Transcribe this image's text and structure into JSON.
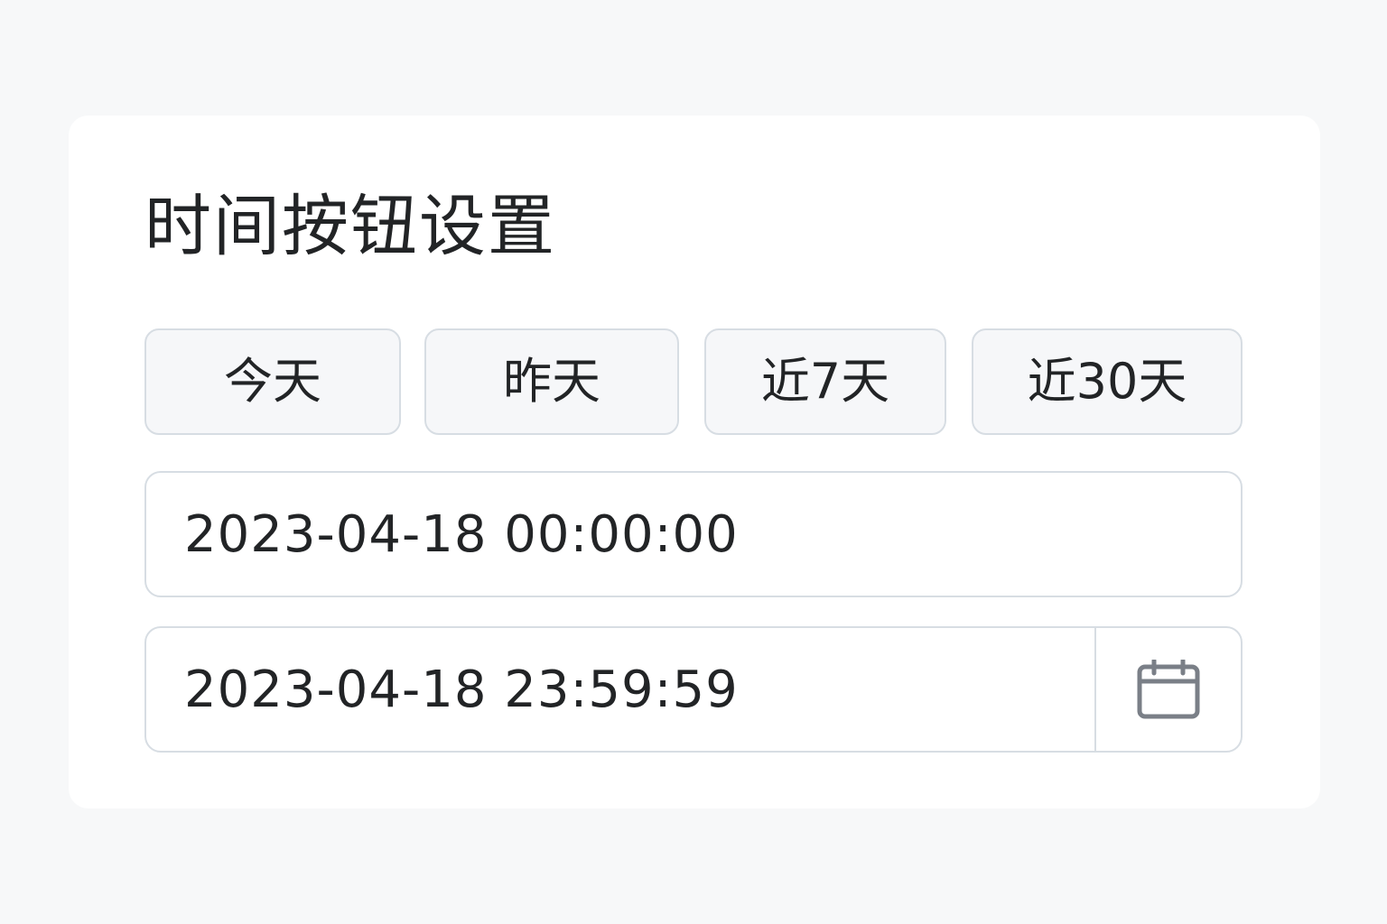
{
  "card": {
    "title": "时间按钮设置"
  },
  "quick_buttons": [
    {
      "label": "今天"
    },
    {
      "label": "昨天"
    },
    {
      "label": "近7天"
    },
    {
      "label": "近30天"
    }
  ],
  "range": {
    "start_value": "2023-04-18 00:00:00",
    "end_value": "2023-04-18 23:59:59"
  },
  "icons": {
    "calendar": "calendar-icon"
  },
  "colors": {
    "background": "#f7f8f9",
    "card": "#ffffff",
    "border": "#d7dde3",
    "button_bg": "#f6f7f9",
    "text": "#222426",
    "icon": "#7a7f87"
  }
}
